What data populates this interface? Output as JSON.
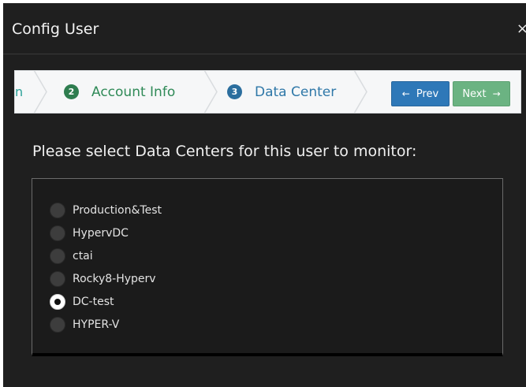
{
  "dialog": {
    "title": "Config User",
    "close_glyph": "×"
  },
  "wizard": {
    "prev_step_fragment": "n",
    "steps": [
      {
        "number": "2",
        "label": "Account Info",
        "state": "done"
      },
      {
        "number": "3",
        "label": "Data Center",
        "state": "active"
      }
    ],
    "prev_button": {
      "arrow": "←",
      "label": "Prev"
    },
    "next_button": {
      "label": "Next",
      "arrow": "→"
    }
  },
  "prompt": "Please select Data Centers for this user to monitor:",
  "data_centers": [
    {
      "label": "Production&Test",
      "selected": false
    },
    {
      "label": "HypervDC",
      "selected": false
    },
    {
      "label": "ctai",
      "selected": false
    },
    {
      "label": "Rocky8-Hyperv",
      "selected": false
    },
    {
      "label": "DC-test",
      "selected": true
    },
    {
      "label": "HYPER-V",
      "selected": false
    }
  ],
  "colors": {
    "background": "#1f1f1f",
    "step_done": "#2e7d4f",
    "step_active": "#2b6e9e",
    "prev_button": "#2e78b8",
    "next_button": "#6bb382"
  }
}
